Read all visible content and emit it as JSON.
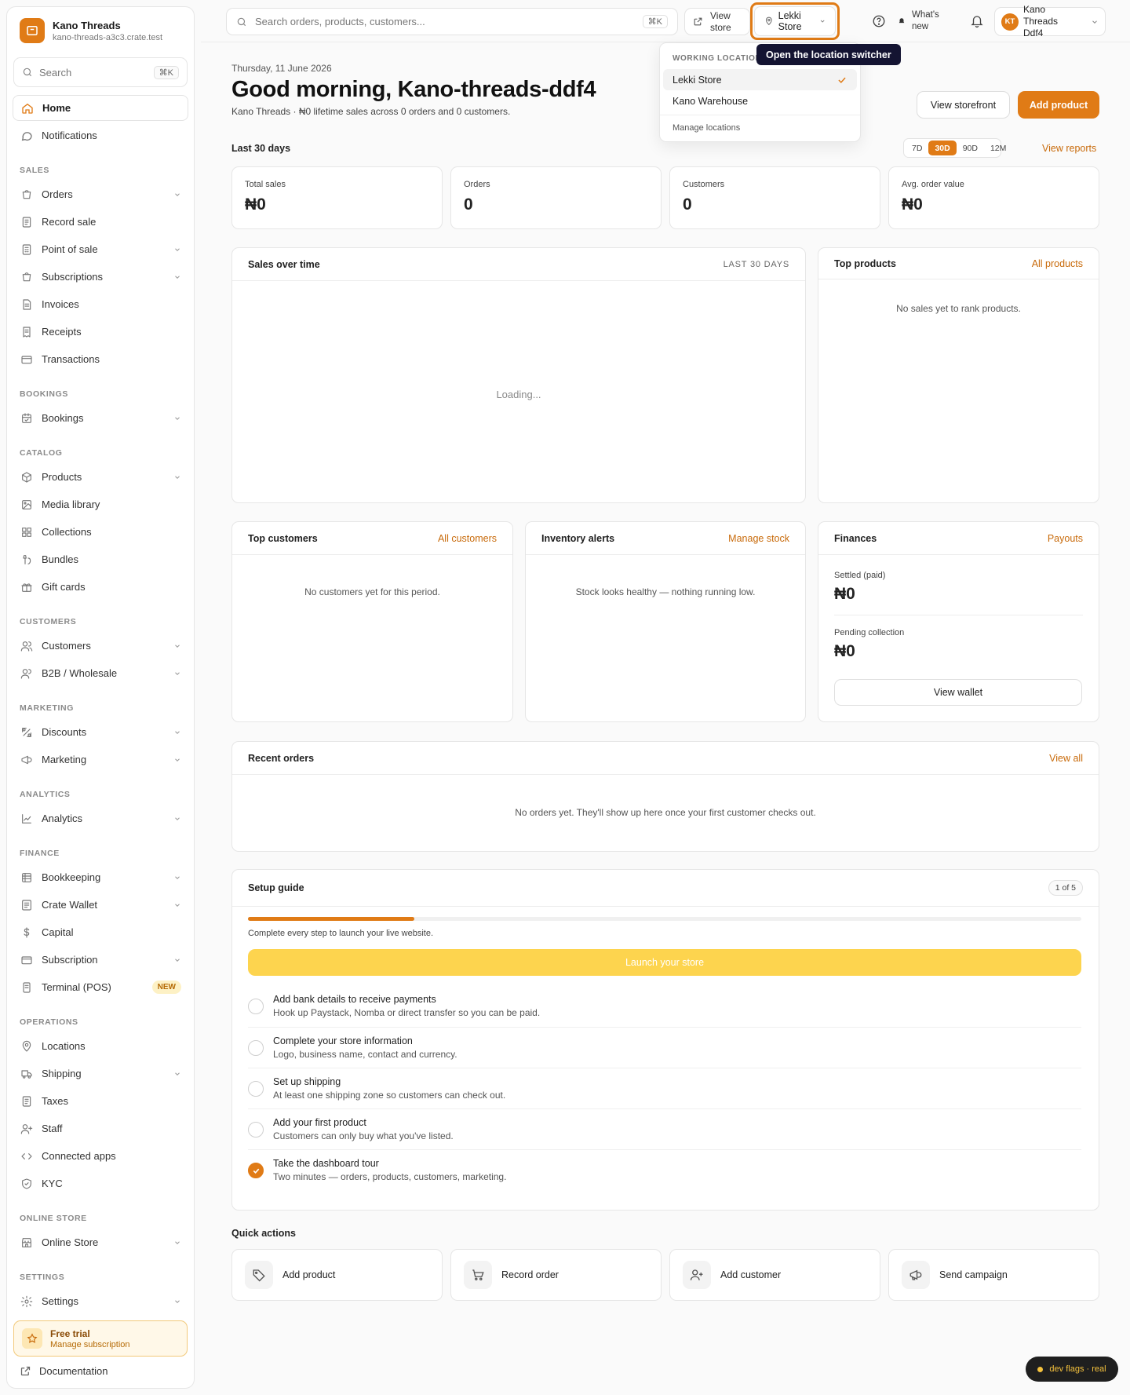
{
  "brand": {
    "name": "Kano Threads",
    "domain": "kano-threads-a3c3.crate.test"
  },
  "sidebar": {
    "search_label": "Search",
    "search_kbd": "⌘K",
    "items": [
      {
        "label": "Home"
      },
      {
        "label": "Notifications"
      }
    ],
    "sections": [
      {
        "title": "SALES",
        "items": [
          "Orders",
          "Record sale",
          "Point of sale",
          "Subscriptions",
          "Invoices",
          "Receipts",
          "Transactions"
        ]
      },
      {
        "title": "BOOKINGS",
        "items": [
          "Bookings"
        ]
      },
      {
        "title": "CATALOG",
        "items": [
          "Products",
          "Media library",
          "Collections",
          "Bundles",
          "Gift cards"
        ]
      },
      {
        "title": "CUSTOMERS",
        "items": [
          "Customers",
          "B2B / Wholesale"
        ]
      },
      {
        "title": "MARKETING",
        "items": [
          "Discounts",
          "Marketing"
        ]
      },
      {
        "title": "ANALYTICS",
        "items": [
          "Analytics"
        ]
      },
      {
        "title": "FINANCE",
        "items": [
          "Bookkeeping",
          "Crate Wallet",
          "Capital",
          "Subscription",
          "Terminal (POS)"
        ]
      },
      {
        "title": "OPERATIONS",
        "items": [
          "Locations",
          "Shipping",
          "Taxes",
          "Staff",
          "Connected apps",
          "KYC"
        ]
      },
      {
        "title": "ONLINE STORE",
        "items": [
          "Online Store"
        ]
      },
      {
        "title": "SETTINGS",
        "items": [
          "Settings"
        ]
      }
    ],
    "new_badge": "NEW",
    "trial_title": "Free trial",
    "trial_sub": "Manage subscription",
    "docs": "Documentation"
  },
  "topbar": {
    "search_placeholder": "Search orders, products, customers...",
    "search_kbd": "⌘K",
    "view_store_1": "View",
    "view_store_2": "store",
    "location": "Lekki Store",
    "whats_new_1": "What's",
    "whats_new_2": "new",
    "user_initials": "KT",
    "user_1": "Kano",
    "user_2": "Threads",
    "user_3": "Ddf4"
  },
  "location_dropdown": {
    "heading": "WORKING LOCATION",
    "options": [
      "Lekki Store",
      "Kano Warehouse"
    ],
    "selected": "Lekki Store",
    "manage": "Manage locations"
  },
  "tooltip": "Open the location switcher",
  "header": {
    "date": "Thursday, 11 June 2026",
    "greeting": "Good morning, Kano-threads-ddf4",
    "lifetime": "Kano Threads · ₦0 lifetime sales across 0 orders and 0 customers.",
    "view_storefront": "View storefront",
    "add_product": "Add product"
  },
  "period": {
    "label": "Last 30 days",
    "ranges": [
      "7D",
      "30D",
      "90D",
      "12M"
    ],
    "active_range": "30D",
    "view_reports": "View reports"
  },
  "kpis": [
    {
      "label": "Total sales",
      "value": "₦0"
    },
    {
      "label": "Orders",
      "value": "0"
    },
    {
      "label": "Customers",
      "value": "0"
    },
    {
      "label": "Avg. order value",
      "value": "₦0"
    }
  ],
  "sales_chart": {
    "title": "Sales over time",
    "range": "LAST 30 DAYS",
    "status": "Loading..."
  },
  "top_products": {
    "title": "Top products",
    "link": "All products",
    "empty": "No sales yet to rank products."
  },
  "top_customers": {
    "title": "Top customers",
    "link": "All customers",
    "empty": "No customers yet for this period."
  },
  "inventory": {
    "title": "Inventory alerts",
    "link": "Manage stock",
    "empty": "Stock looks healthy — nothing running low."
  },
  "finances": {
    "title": "Finances",
    "link": "Payouts",
    "settled_label": "Settled (paid)",
    "settled_value": "₦0",
    "pending_label": "Pending collection",
    "pending_value": "₦0",
    "wallet_button": "View wallet"
  },
  "recent_orders": {
    "title": "Recent orders",
    "link": "View all",
    "empty": "No orders yet. They'll show up here once your first customer checks out."
  },
  "setup": {
    "title": "Setup guide",
    "count": "1 of 5",
    "progress": 0.2,
    "caption": "Complete every step to launch your live website.",
    "launch": "Launch your store",
    "steps": [
      {
        "title": "Add bank details to receive payments",
        "desc": "Hook up Paystack, Nomba or direct transfer so you can be paid.",
        "done": false
      },
      {
        "title": "Complete your store information",
        "desc": "Logo, business name, contact and currency.",
        "done": false
      },
      {
        "title": "Set up shipping",
        "desc": "At least one shipping zone so customers can check out.",
        "done": false
      },
      {
        "title": "Add your first product",
        "desc": "Customers can only buy what you've listed.",
        "done": false
      },
      {
        "title": "Take the dashboard tour",
        "desc": "Two minutes — orders, products, customers, marketing.",
        "done": true
      }
    ]
  },
  "quick_actions": {
    "title": "Quick actions",
    "items": [
      "Add product",
      "Record order",
      "Add customer",
      "Send campaign"
    ]
  },
  "dev_flags": "dev flags · real",
  "colors": {
    "accent": "#e07b16",
    "launch": "#fdd44e",
    "tooltip": "#141432"
  }
}
